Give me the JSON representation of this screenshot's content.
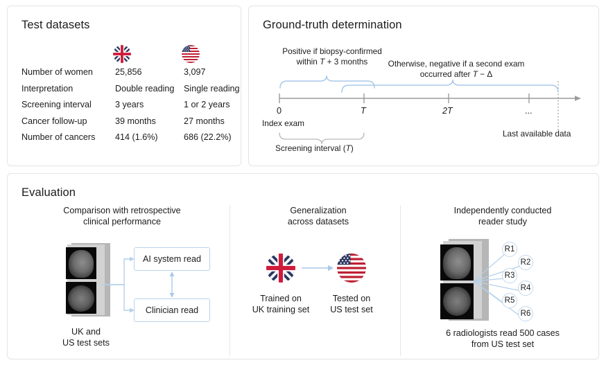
{
  "panels": {
    "test_datasets": {
      "title": "Test datasets",
      "flags": [
        {
          "name": "uk-flag",
          "label": "United Kingdom"
        },
        {
          "name": "us-flag",
          "label": "United States"
        }
      ],
      "rows": [
        {
          "label": "Number of women",
          "uk": "25,856",
          "us": "3,097"
        },
        {
          "label": "Interpretation",
          "uk": "Double reading",
          "us": "Single reading"
        },
        {
          "label": "Screening interval",
          "uk": "3 years",
          "us": "1 or 2 years"
        },
        {
          "label": "Cancer follow-up",
          "uk": "39 months",
          "us": "27 months"
        },
        {
          "label": "Number of cancers",
          "uk": "414 (1.6%)",
          "us": "686 (22.2%)"
        }
      ]
    },
    "ground_truth": {
      "title": "Ground-truth determination",
      "positive_note_line1": "Positive if biopsy-confirmed",
      "positive_note_line2_pre": "within ",
      "positive_note_line2_var": "T",
      "positive_note_line2_post": " + 3 months",
      "negative_note_line1": "Otherwise, negative if a second exam",
      "negative_note_line2_pre": "occurred after ",
      "negative_note_line2_var": "T",
      "negative_note_line2_post": " − Δ",
      "ticks": [
        {
          "label": "0",
          "italic": false
        },
        {
          "label": "T",
          "italic": true
        },
        {
          "label": "2T",
          "italic": true
        },
        {
          "label": "...",
          "italic": false
        }
      ],
      "index_exam_label": "Index exam",
      "last_data_label": "Last available data",
      "screening_interval_pre": "Screening interval (",
      "screening_interval_var": "T",
      "screening_interval_post": ")"
    },
    "evaluation": {
      "title": "Evaluation",
      "columns": [
        {
          "name": "comparison",
          "heading": "Comparison with retrospective\nclinical performance",
          "box_ai": "AI system read",
          "box_clinician": "Clinician read",
          "caption": "UK and\nUS test sets"
        },
        {
          "name": "generalization",
          "heading": "Generalization\nacross datasets",
          "caption_left": "Trained on\nUK training set",
          "caption_right": "Tested on\nUS test set"
        },
        {
          "name": "reader-study",
          "heading": "Independently conducted\nreader study",
          "readers": [
            "R1",
            "R2",
            "R3",
            "R4",
            "R5",
            "R6"
          ],
          "caption": "6 radiologists read 500 cases\nfrom US test set"
        }
      ]
    }
  },
  "colors": {
    "card_border": "#e3e3e3",
    "accent_blue": "#8cb4dd",
    "box_border": "#b9d3ec",
    "axis_gray": "#9b9b9b",
    "text": "#1b1b1b"
  }
}
